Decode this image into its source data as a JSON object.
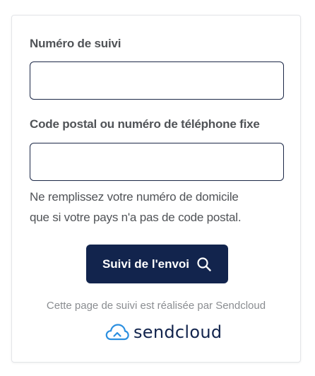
{
  "form": {
    "tracking_label": "Numéro de suivi",
    "tracking_value": "",
    "postal_label": "Code postal ou numéro de téléphone fixe",
    "postal_value": "",
    "helper_line1": "Ne remplissez votre numéro de domicile",
    "helper_line2": "que si votre pays n'a pas de code postal.",
    "submit_label": "Suivi de l'envoi",
    "submit_icon": "search-icon"
  },
  "footer": {
    "powered_by": "Cette page de suivi est réalisée par Sendcloud",
    "logo_icon": "cloud-icon",
    "logo_text": "sendcloud"
  },
  "colors": {
    "primary": "#12244d",
    "logo_blue": "#2b8fe0",
    "label_text": "#505357",
    "muted_text": "#8a8d91"
  }
}
